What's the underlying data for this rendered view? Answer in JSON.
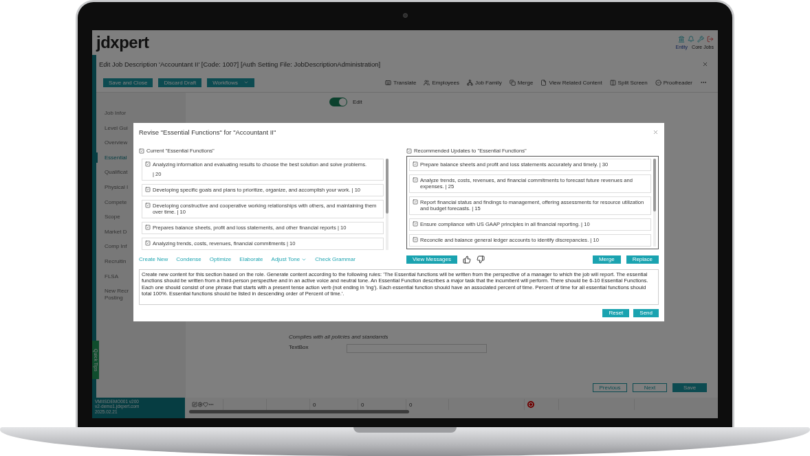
{
  "app": {
    "logo": "jdxpert",
    "header_links": [
      "Entity",
      "Core Jobs"
    ],
    "title": "Edit Job Description 'Accountant II'  [Code: 1007] [Auth Setting File: JobDescriptionAdministration]"
  },
  "actions": {
    "buttons": [
      {
        "label": "Save and Close",
        "kind": "plain"
      },
      {
        "label": "Discard Draft",
        "kind": "plain"
      },
      {
        "label": "Workflows",
        "kind": "menu"
      }
    ]
  },
  "toolbar": [
    "Translate",
    "Employees",
    "Job Family",
    "Merge",
    "View Related Content",
    "Split Screen",
    "Proofreader"
  ],
  "edit_toggle": {
    "label": "Edit",
    "on": true
  },
  "sidebar": [
    {
      "label": "Job Infor",
      "selected": false
    },
    {
      "label": "Level Gui",
      "selected": false
    },
    {
      "label": "Overview",
      "selected": false
    },
    {
      "label": "Essential",
      "selected": true
    },
    {
      "label": "Qualificat",
      "selected": false
    },
    {
      "label": "Physical I",
      "selected": false
    },
    {
      "label": "Compete",
      "selected": false
    },
    {
      "label": "Scope",
      "selected": false
    },
    {
      "label": "Market D",
      "selected": false
    },
    {
      "label": "Comp Inf",
      "selected": false
    },
    {
      "label": "Recruitin",
      "selected": false
    },
    {
      "label": "FLSA",
      "selected": false
    },
    {
      "label": "New Recr Posting",
      "selected": false
    }
  ],
  "form": {
    "note": "Complies with all policies and standarrds",
    "field_label": "TextBox"
  },
  "nav_buttons": [
    {
      "label": "Previous",
      "kind": "outline"
    },
    {
      "label": "Next",
      "kind": "outline"
    },
    {
      "label": "Save",
      "kind": "primary"
    }
  ],
  "quick_tips": "Quick Tips",
  "footer": {
    "info": [
      "VMIISDEMO001 v200",
      "v2-demo1.jdxpert.com",
      "2025.02.21"
    ],
    "cells": [
      "0",
      "0",
      "0"
    ]
  },
  "dialog": {
    "title": "Revise \"Essential Functions\" for \"Accountant II\"",
    "current": {
      "label": "Current \"Essential Functions\"",
      "checked": true,
      "items": [
        {
          "text": "Analyzing information and evaluating results to choose the best solution and solve problems.",
          "note": "| 20",
          "checked": true
        },
        {
          "text": "Developing specific goals and plans to prioritize, organize, and accomplish your work. | 10",
          "checked": true
        },
        {
          "text": "Developing constructive and cooperative working relationships with others, and maintaining them over time. | 10",
          "checked": true
        },
        {
          "text": "Prepares balance sheets, profit and loss statements, and other financial reports | 10",
          "checked": true
        },
        {
          "text": "Analyzing trends, costs, revenues, financial commitments | 10",
          "checked": true
        }
      ]
    },
    "recommended": {
      "label": "Recommended Updates to \"Essential Functions\"",
      "checked": true,
      "items": [
        {
          "text": "Prepare balance sheets and profit and loss statements accurately and timely. | 30",
          "checked": true
        },
        {
          "text": "Analyze trends, costs, revenues, and financial commitments to forecast future revenues and expenses. | 25",
          "checked": true
        },
        {
          "text": "Report financial status and findings to management, offering assessments for resource utilization and budget forecasts. | 15",
          "checked": true
        },
        {
          "text": "Ensure compliance with US GAAP principles in all financial reporting. | 10",
          "checked": true
        },
        {
          "text": "Reconcile and balance general ledger accounts to identify discrepancies. | 10",
          "checked": true
        }
      ]
    },
    "tools": [
      {
        "label": "Create New",
        "kind": "link"
      },
      {
        "label": "Condense",
        "kind": "link"
      },
      {
        "label": "Optimize",
        "kind": "link"
      },
      {
        "label": "Elaborate",
        "kind": "link"
      },
      {
        "label": "Adjust Tone",
        "kind": "menu"
      },
      {
        "label": "Check Grammar",
        "kind": "link"
      }
    ],
    "view_messages": "View Messages",
    "result_buttons": [
      "Merge",
      "Replace"
    ],
    "prompt": "Create new content for this section based on the role. Generate content according to the following rules: 'The Essential functions will be written from the perspective of a manager to which the job will report. The essential functions should be written from a third-person perspective and in an active voice and neutral tone. An Essential Function describes a major task that the incumbent will perform. There should be 6-10 Essential Functions. Each one should consist of one phrase that starts with a present tense action verb (not ending in 'ing'). Each essential function should have an associated percent of time. Percent of time for all essential functions should total 100%. Essential functions should be listed in descending order of Percent of time.'.",
    "footer_buttons": [
      "Reset",
      "Send"
    ]
  }
}
